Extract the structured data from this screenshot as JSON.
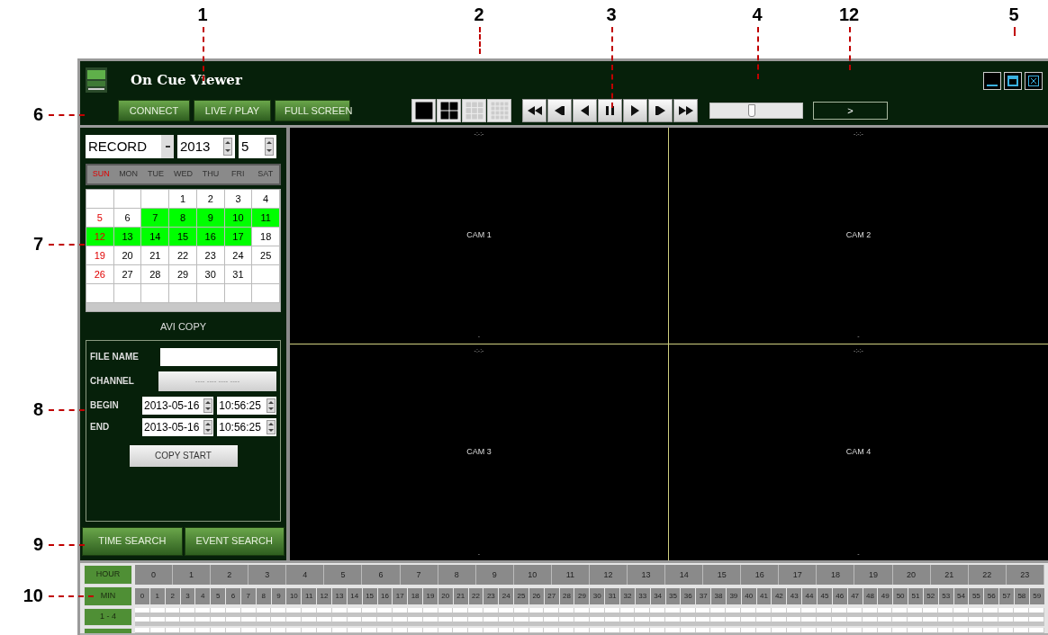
{
  "callouts": [
    {
      "label": "1"
    },
    {
      "label": "2"
    },
    {
      "label": "3"
    },
    {
      "label": "4"
    },
    {
      "label": "12"
    },
    {
      "label": "5"
    },
    {
      "label": "6"
    },
    {
      "label": "7"
    },
    {
      "label": "8"
    },
    {
      "label": "9"
    },
    {
      "label": "10"
    }
  ],
  "window": {
    "title": "On Cue Viewer"
  },
  "toolbar": {
    "buttons": [
      "CONNECT",
      "LIVE / PLAY",
      "FULL SCREEN"
    ],
    "seek": {
      "level": 0.45
    },
    "speed": ">"
  },
  "calendar": {
    "mode": "RECORD",
    "year": "2013",
    "month": "5",
    "weekdays": [
      "SUN",
      "MON",
      "TUE",
      "WED",
      "THU",
      "FRI",
      "SAT"
    ],
    "weeks": [
      [
        {
          "recorded": false
        },
        {
          "recorded": false
        },
        {
          "recorded": false
        },
        {
          "day": "1",
          "recorded": false
        },
        {
          "day": "2",
          "recorded": false
        },
        {
          "day": "3",
          "recorded": false
        },
        {
          "day": "4",
          "recorded": false
        }
      ],
      [
        {
          "day": "5",
          "recorded": false
        },
        {
          "day": "6",
          "recorded": false
        },
        {
          "day": "7",
          "recorded": true
        },
        {
          "day": "8",
          "recorded": true
        },
        {
          "day": "9",
          "recorded": true
        },
        {
          "day": "10",
          "recorded": true
        },
        {
          "day": "11",
          "recorded": true
        }
      ],
      [
        {
          "day": "12",
          "recorded": true
        },
        {
          "day": "13",
          "recorded": true
        },
        {
          "day": "14",
          "recorded": true
        },
        {
          "day": "15",
          "recorded": true
        },
        {
          "day": "16",
          "recorded": true
        },
        {
          "day": "17",
          "recorded": true
        },
        {
          "day": "18",
          "recorded": false
        }
      ],
      [
        {
          "day": "19",
          "recorded": false
        },
        {
          "day": "20",
          "recorded": false
        },
        {
          "day": "21",
          "recorded": false
        },
        {
          "day": "22",
          "recorded": false
        },
        {
          "day": "23",
          "recorded": false
        },
        {
          "day": "24",
          "recorded": false
        },
        {
          "day": "25",
          "recorded": false
        }
      ],
      [
        {
          "day": "26",
          "recorded": false
        },
        {
          "day": "27",
          "recorded": false
        },
        {
          "day": "28",
          "recorded": false
        },
        {
          "day": "29",
          "recorded": false
        },
        {
          "day": "30",
          "recorded": false
        },
        {
          "day": "31",
          "recorded": false
        },
        {
          "recorded": false
        }
      ],
      [
        {
          "recorded": false
        },
        {
          "recorded": false
        },
        {
          "recorded": false
        },
        {
          "recorded": false
        },
        {
          "recorded": false
        },
        {
          "recorded": false
        },
        {
          "recorded": false
        }
      ]
    ]
  },
  "avi_copy": {
    "title": "AVI COPY",
    "file_name_label": "FILE NAME",
    "channel_label": "CHANNEL",
    "channel_value": "---- ---- ---- ----",
    "begin_label": "BEGIN",
    "begin_date": "2013-05-16",
    "begin_time": "10:56:25",
    "end_label": "END",
    "end_date": "2013-05-16",
    "end_time": "10:56:25",
    "button": "COPY START"
  },
  "search_tabs": [
    "TIME SEARCH",
    "EVENT SEARCH"
  ],
  "cameras": [
    {
      "label": "CAM 1",
      "time": "-:-:-",
      "footer": "-"
    },
    {
      "label": "CAM 2",
      "time": "-:-:-",
      "footer": "-"
    },
    {
      "label": "CAM 3",
      "time": "-:-:-",
      "footer": "-"
    },
    {
      "label": "CAM 4",
      "time": "-:-:-",
      "footer": "-"
    }
  ],
  "timeline": {
    "hour_label": "HOUR",
    "min_label": "MIN",
    "hours": [
      "0",
      "1",
      "2",
      "3",
      "4",
      "5",
      "6",
      "7",
      "8",
      "9",
      "10",
      "11",
      "12",
      "13",
      "14",
      "15",
      "16",
      "17",
      "18",
      "19",
      "20",
      "21",
      "22",
      "23"
    ],
    "minutes": [
      "0",
      "1",
      "2",
      "3",
      "4",
      "5",
      "6",
      "7",
      "8",
      "9",
      "10",
      "11",
      "12",
      "13",
      "14",
      "15",
      "16",
      "17",
      "18",
      "19",
      "20",
      "21",
      "22",
      "23",
      "24",
      "25",
      "26",
      "27",
      "28",
      "29",
      "30",
      "31",
      "32",
      "33",
      "34",
      "35",
      "36",
      "37",
      "38",
      "39",
      "40",
      "41",
      "42",
      "43",
      "44",
      "45",
      "46",
      "47",
      "48",
      "49",
      "50",
      "51",
      "52",
      "53",
      "54",
      "55",
      "56",
      "57",
      "58",
      "59"
    ],
    "channel_rows": [
      "1 - 4"
    ]
  }
}
